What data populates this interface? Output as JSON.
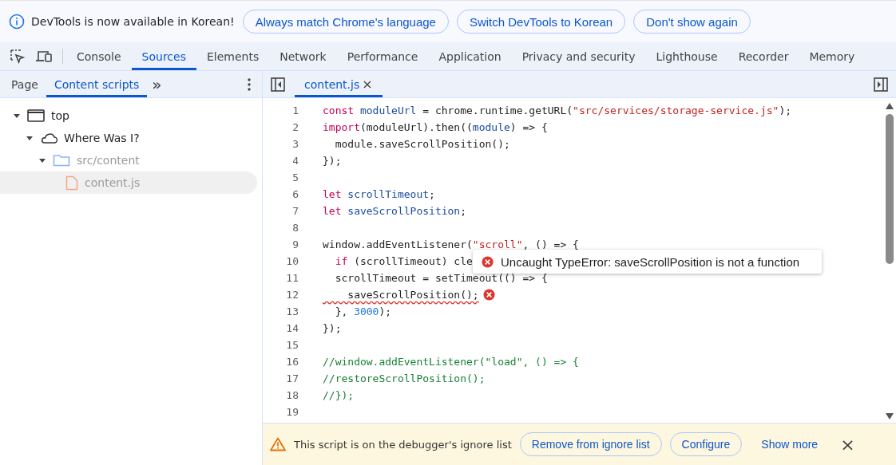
{
  "banner": {
    "message": "DevTools is now available in Korean!",
    "buttons": [
      "Always match Chrome's language",
      "Switch DevTools to Korean",
      "Don't show again"
    ]
  },
  "main_tabs": [
    {
      "label": "Console",
      "selected": false
    },
    {
      "label": "Sources",
      "selected": true
    },
    {
      "label": "Elements",
      "selected": false
    },
    {
      "label": "Network",
      "selected": false
    },
    {
      "label": "Performance",
      "selected": false
    },
    {
      "label": "Application",
      "selected": false
    },
    {
      "label": "Privacy and security",
      "selected": false
    },
    {
      "label": "Lighthouse",
      "selected": false
    },
    {
      "label": "Recorder",
      "selected": false
    },
    {
      "label": "Memory",
      "selected": false
    }
  ],
  "navigator": {
    "tabs": [
      {
        "label": "Page",
        "selected": false
      },
      {
        "label": "Content scripts",
        "selected": true
      }
    ],
    "more": "»",
    "tree": [
      {
        "kind": "frame",
        "label": "top",
        "expanded": true,
        "selected": false,
        "children": [
          {
            "kind": "extension",
            "label": "Where Was I?",
            "expanded": true,
            "selected": false,
            "children": [
              {
                "kind": "folder",
                "label": "src/content",
                "expanded": true,
                "selected": false,
                "children": [
                  {
                    "kind": "file",
                    "label": "content.js",
                    "selected": true
                  }
                ]
              }
            ]
          }
        ]
      }
    ]
  },
  "editor": {
    "file_tab": {
      "label": "content.js",
      "close": "×"
    },
    "lines": [
      {
        "number": "1",
        "tokens": [
          {
            "kind": "keyword",
            "text": "const "
          },
          {
            "kind": "def",
            "text": "moduleUrl"
          },
          {
            "kind": "plain",
            "text": " = chrome.runtime.getURL("
          },
          {
            "kind": "string",
            "text": "\"src/services/storage-service.js\""
          },
          {
            "kind": "plain",
            "text": ");"
          }
        ]
      },
      {
        "number": "2",
        "tokens": [
          {
            "kind": "keyword",
            "text": "import"
          },
          {
            "kind": "plain",
            "text": "(moduleUrl).then(("
          },
          {
            "kind": "def",
            "text": "module"
          },
          {
            "kind": "plain",
            "text": ") => {"
          }
        ]
      },
      {
        "number": "3",
        "tokens": [
          {
            "kind": "plain",
            "text": "  module.saveScrollPosition();"
          }
        ]
      },
      {
        "number": "4",
        "tokens": [
          {
            "kind": "plain",
            "text": "});"
          }
        ]
      },
      {
        "number": "5"
      },
      {
        "number": "6",
        "tokens": [
          {
            "kind": "keyword",
            "text": "let "
          },
          {
            "kind": "def",
            "text": "scrollTimeout"
          },
          {
            "kind": "plain",
            "text": ";"
          }
        ]
      },
      {
        "number": "7",
        "tokens": [
          {
            "kind": "keyword",
            "text": "let "
          },
          {
            "kind": "def",
            "text": "saveScrollPosition"
          },
          {
            "kind": "plain",
            "text": ";"
          }
        ]
      },
      {
        "number": "8"
      },
      {
        "number": "9",
        "tokens": [
          {
            "kind": "plain",
            "text": "window.addEventListener("
          },
          {
            "kind": "string",
            "text": "\"scroll\""
          },
          {
            "kind": "plain",
            "text": ", () => {"
          }
        ]
      },
      {
        "number": "10",
        "tokens": [
          {
            "kind": "keyword",
            "text": "  if"
          },
          {
            "kind": "plain",
            "text": " (scrollTimeout) cle"
          }
        ]
      },
      {
        "number": "11",
        "tokens": [
          {
            "kind": "plain",
            "text": "  scrollTimeout = setTimeout(() => {"
          }
        ]
      },
      {
        "number": "12",
        "error": true,
        "tokens": [
          {
            "kind": "plain",
            "text": "    saveScrollPosition();"
          }
        ]
      },
      {
        "number": "13",
        "tokens": [
          {
            "kind": "plain",
            "text": "  }, "
          },
          {
            "kind": "number",
            "text": "3000"
          },
          {
            "kind": "plain",
            "text": ");"
          }
        ]
      },
      {
        "number": "14",
        "tokens": [
          {
            "kind": "plain",
            "text": "});"
          }
        ]
      },
      {
        "number": "15"
      },
      {
        "number": "16",
        "tokens": [
          {
            "kind": "comment",
            "text": "//window.addEventListener(\"load\", () => {"
          }
        ]
      },
      {
        "number": "17",
        "tokens": [
          {
            "kind": "comment",
            "text": "//restoreScrollPosition();"
          }
        ]
      },
      {
        "number": "18",
        "tokens": [
          {
            "kind": "comment",
            "text": "//});"
          }
        ]
      },
      {
        "number": "19"
      }
    ],
    "error_tooltip": "Uncaught TypeError: saveScrollPosition is not a function"
  },
  "ignore_bar": {
    "message": "This script is on the debugger's ignore list",
    "buttons": [
      "Remove from ignore list",
      "Configure"
    ],
    "link": "Show more",
    "close": "×"
  }
}
